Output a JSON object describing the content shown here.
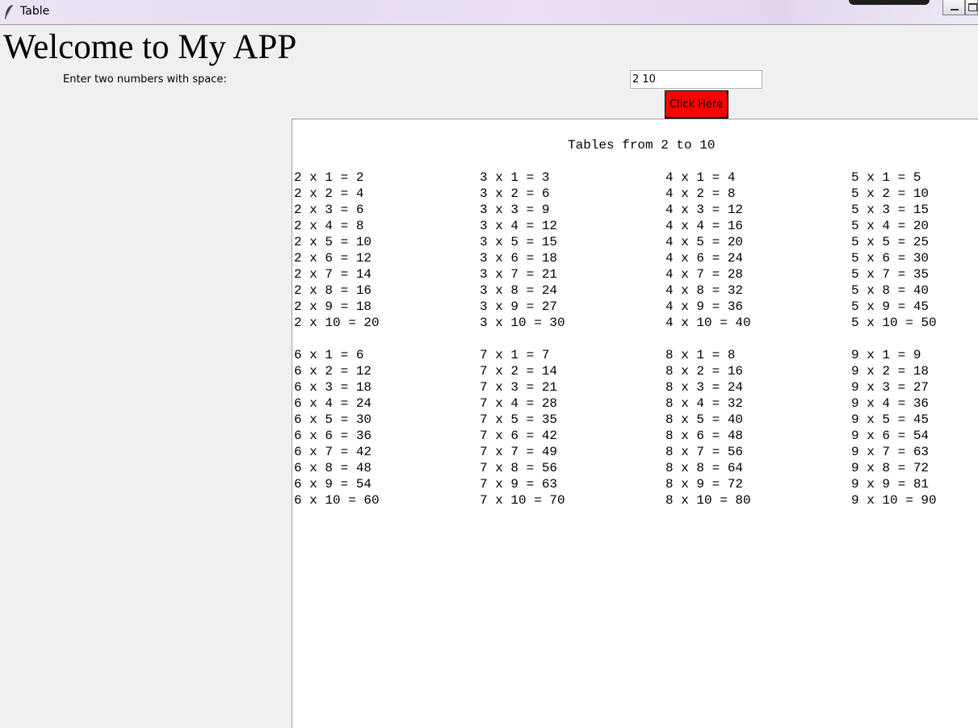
{
  "window": {
    "title": "Table",
    "icon": "feather-icon"
  },
  "heading": "Welcome to My APP",
  "prompt": {
    "label": "Enter two numbers with space:",
    "input_value": "2 10",
    "button_label": "Click Here",
    "button_color": "#ff0000"
  },
  "output": {
    "title": "Tables from 2 to 10",
    "tables": [
      {
        "number": 2,
        "lines": [
          "2 x 1 = 2",
          "2 x 2 = 4",
          "2 x 3 = 6",
          "2 x 4 = 8",
          "2 x 5 = 10",
          "2 x 6 = 12",
          "2 x 7 = 14",
          "2 x 8 = 16",
          "2 x 9 = 18",
          "2 x 10 = 20"
        ]
      },
      {
        "number": 3,
        "lines": [
          "3 x 1 = 3",
          "3 x 2 = 6",
          "3 x 3 = 9",
          "3 x 4 = 12",
          "3 x 5 = 15",
          "3 x 6 = 18",
          "3 x 7 = 21",
          "3 x 8 = 24",
          "3 x 9 = 27",
          "3 x 10 = 30"
        ]
      },
      {
        "number": 4,
        "lines": [
          "4 x 1 = 4",
          "4 x 2 = 8",
          "4 x 3 = 12",
          "4 x 4 = 16",
          "4 x 5 = 20",
          "4 x 6 = 24",
          "4 x 7 = 28",
          "4 x 8 = 32",
          "4 x 9 = 36",
          "4 x 10 = 40"
        ]
      },
      {
        "number": 5,
        "lines": [
          "5 x 1 = 5",
          "5 x 2 = 10",
          "5 x 3 = 15",
          "5 x 4 = 20",
          "5 x 5 = 25",
          "5 x 6 = 30",
          "5 x 7 = 35",
          "5 x 8 = 40",
          "5 x 9 = 45",
          "5 x 10 = 50"
        ]
      },
      {
        "number": 6,
        "lines": [
          "6 x 1 = 6",
          "6 x 2 = 12",
          "6 x 3 = 18",
          "6 x 4 = 24",
          "6 x 5 = 30",
          "6 x 6 = 36",
          "6 x 7 = 42",
          "6 x 8 = 48",
          "6 x 9 = 54",
          "6 x 10 = 60"
        ]
      },
      {
        "number": 7,
        "lines": [
          "7 x 1 = 7",
          "7 x 2 = 14",
          "7 x 3 = 21",
          "7 x 4 = 28",
          "7 x 5 = 35",
          "7 x 6 = 42",
          "7 x 7 = 49",
          "7 x 8 = 56",
          "7 x 9 = 63",
          "7 x 10 = 70"
        ]
      },
      {
        "number": 8,
        "lines": [
          "8 x 1 = 8",
          "8 x 2 = 16",
          "8 x 3 = 24",
          "8 x 4 = 32",
          "8 x 5 = 40",
          "8 x 6 = 48",
          "8 x 7 = 56",
          "8 x 8 = 64",
          "8 x 9 = 72",
          "8 x 10 = 80"
        ]
      },
      {
        "number": 9,
        "lines": [
          "9 x 1 = 9",
          "9 x 2 = 18",
          "9 x 3 = 27",
          "9 x 4 = 36",
          "9 x 5 = 45",
          "9 x 6 = 54",
          "9 x 7 = 63",
          "9 x 8 = 72",
          "9 x 9 = 81",
          "9 x 10 = 90"
        ]
      }
    ]
  }
}
